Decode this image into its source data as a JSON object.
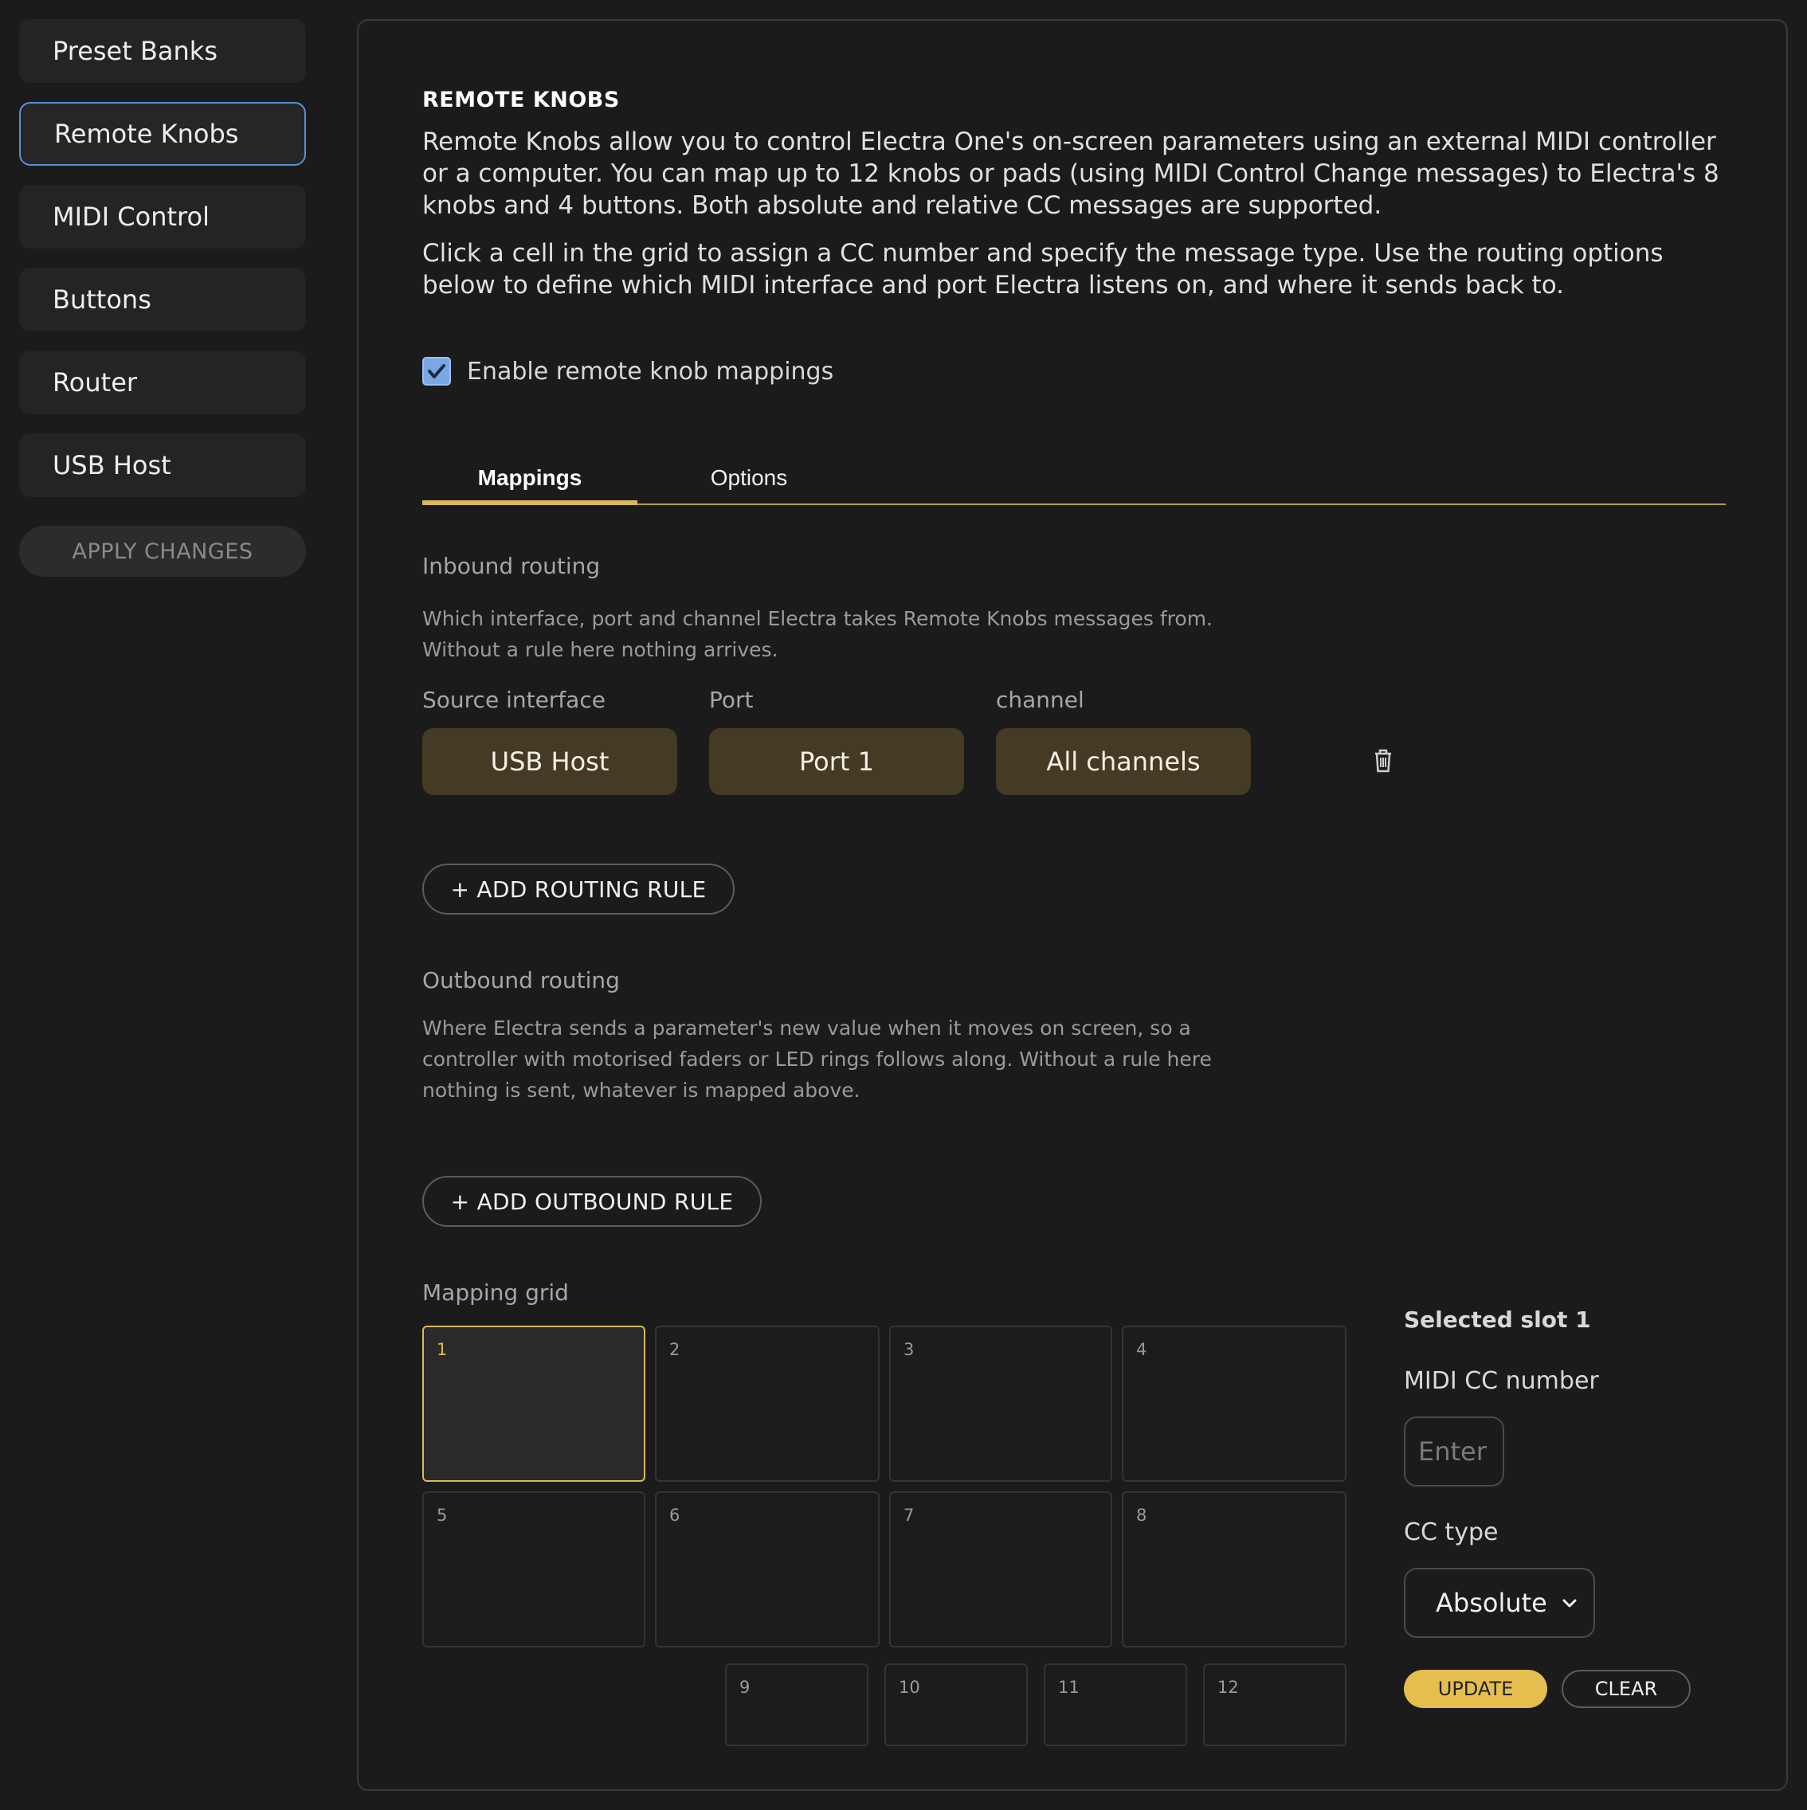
{
  "sidebar": {
    "items": [
      {
        "label": "Preset Banks"
      },
      {
        "label": "Remote Knobs",
        "active": true
      },
      {
        "label": "MIDI Control"
      },
      {
        "label": "Buttons"
      },
      {
        "label": "Router"
      },
      {
        "label": "USB Host"
      }
    ],
    "apply_label": "APPLY CHANGES"
  },
  "main": {
    "title": "REMOTE KNOBS",
    "intro_1": "Remote Knobs allow you to control Electra One's on-screen parameters using an external MIDI controller or a computer. You can map up to 12 knobs or pads (using MIDI Control Change messages) to Electra's 8 knobs and 4 buttons. Both absolute and relative CC messages are supported.",
    "intro_2": "Click a cell in the grid to assign a CC number and specify the message type. Use the routing options below to define which MIDI interface and port Electra listens on, and where it sends back to.",
    "enable_label": "Enable remote knob mappings",
    "enable_checked": true,
    "tabs": [
      {
        "label": "Mappings",
        "active": true
      },
      {
        "label": "Options"
      }
    ],
    "inbound": {
      "title": "Inbound routing",
      "description": "Which interface, port and channel Electra takes Remote Knobs messages from. Without a rule here nothing arrives.",
      "col_source": "Source interface",
      "col_port": "Port",
      "col_channel": "channel",
      "rule": {
        "source": "USB Host",
        "port": "Port 1",
        "channel": "All channels"
      },
      "add_label": "+ ADD ROUTING RULE"
    },
    "outbound": {
      "title": "Outbound routing",
      "description": "Where Electra sends a parameter's new value when it moves on screen, so a controller with motorised faders or LED rings follows along. Without a rule here nothing is sent, whatever is mapped above.",
      "add_label": "+ ADD OUTBOUND RULE"
    },
    "grid": {
      "title": "Mapping grid",
      "cells": [
        "1",
        "2",
        "3",
        "4",
        "5",
        "6",
        "7",
        "8",
        "9",
        "10",
        "11",
        "12"
      ],
      "selected": "1"
    },
    "editor": {
      "slot_title": "Selected slot 1",
      "cc_label": "MIDI CC number",
      "cc_placeholder": "Enter",
      "type_label": "CC type",
      "type_value": "Absolute",
      "update_label": "UPDATE",
      "clear_label": "CLEAR"
    }
  },
  "colors": {
    "accent": "#e6be50",
    "active_border": "#5a8fd6",
    "pill_bg": "#453a24"
  }
}
